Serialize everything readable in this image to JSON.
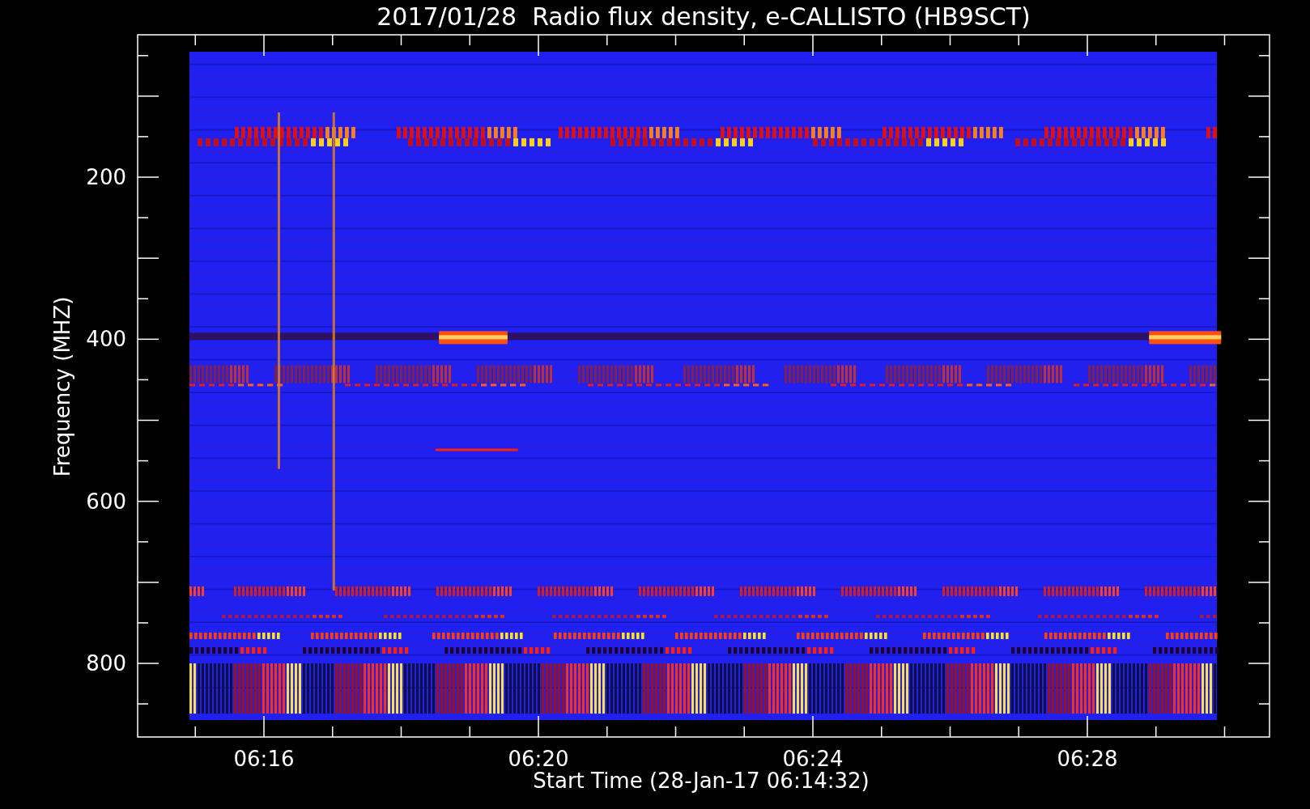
{
  "title": "2017/01/28  Radio flux density, e-CALLISTO (HB9SCT)",
  "y_axis": {
    "label": "Frequency (MHZ)",
    "ticks": [
      "200",
      "400",
      "600",
      "800"
    ]
  },
  "x_axis": {
    "label": "Start Time (28-Jan-17 06:14:32)",
    "ticks": [
      "06:16",
      "06:20",
      "06:24",
      "06:28"
    ]
  }
}
